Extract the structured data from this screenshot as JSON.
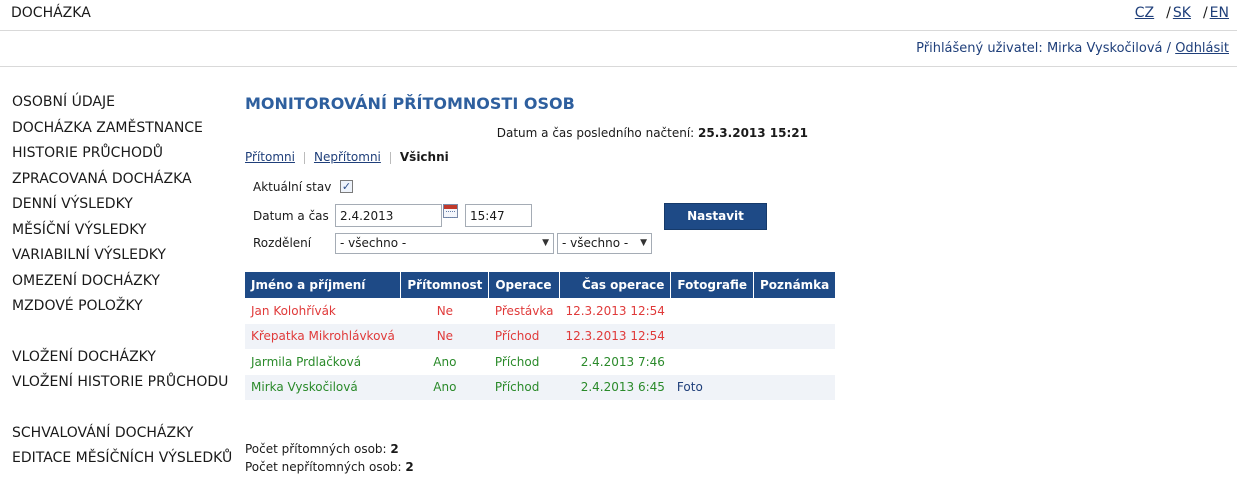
{
  "app": {
    "title": "DOCHÁZKA"
  },
  "languages": [
    "CZ",
    "SK",
    "EN"
  ],
  "user": {
    "prefix": "Přihlášený uživatel:",
    "name": "Mirka Vyskočilová",
    "logout": "Odhlásit"
  },
  "sidebar": {
    "group1": [
      "OSOBNÍ ÚDAJE",
      "DOCHÁZKA ZAMĚSTNANCE",
      "HISTORIE PRŮCHODŮ",
      "ZPRACOVANÁ DOCHÁZKA",
      "DENNÍ VÝSLEDKY",
      "MĚSÍČNÍ VÝSLEDKY",
      "VARIABILNÍ VÝSLEDKY",
      "OMEZENÍ DOCHÁZKY",
      "MZDOVÉ POLOŽKY"
    ],
    "group2": [
      "VLOŽENÍ DOCHÁZKY",
      "VLOŽENÍ HISTORIE PRŮCHODU"
    ],
    "group3": [
      "SCHVALOVÁNÍ DOCHÁZKY",
      "EDITACE MĚSÍČNÍCH VÝSLEDKŮ"
    ]
  },
  "main": {
    "title": "MONITOROVÁNÍ PŘÍTOMNOSTI OSOB",
    "last_load_label": "Datum a čas posledního načtení:",
    "last_load_value": "25.3.2013 15:21",
    "tabs": [
      "Přítomni",
      "Nepřítomni",
      "Všichni"
    ],
    "form": {
      "current_state_label": "Aktuální stav",
      "current_state_checked": true,
      "datetime_label": "Datum a čas",
      "date_value": "2.4.2013",
      "time_value": "15:47",
      "division_label": "Rozdělení",
      "division_value_1": "- všechno -",
      "division_value_2": "- všechno -",
      "submit_label": "Nastavit"
    },
    "table": {
      "headers": [
        "Jméno a příjmení",
        "Přítomnost",
        "Operace",
        "Čas operace",
        "Fotografie",
        "Poznámka"
      ],
      "rows": [
        {
          "name": "Jan Kolohřívák",
          "presence": "Ne",
          "operation": "Přestávka",
          "time": "12.3.2013 12:54",
          "photo": "",
          "note": "",
          "status": "red"
        },
        {
          "name": "Křepatka Mikrohlávková",
          "presence": "Ne",
          "operation": "Příchod",
          "time": "12.3.2013 12:54",
          "photo": "",
          "note": "",
          "status": "red"
        },
        {
          "name": "Jarmila Prdlačková",
          "presence": "Ano",
          "operation": "Příchod",
          "time": "2.4.2013 7:46",
          "photo": "",
          "note": "",
          "status": "green"
        },
        {
          "name": "Mirka Vyskočilová",
          "presence": "Ano",
          "operation": "Příchod",
          "time": "2.4.2013 6:45",
          "photo": "Foto",
          "note": "",
          "status": "green"
        }
      ]
    },
    "summary": {
      "present_label": "Počet přítomných osob:",
      "present_count": "2",
      "absent_label": "Počet nepřítomných osob:",
      "absent_count": "2"
    }
  },
  "colors": {
    "accent": "#1e4a86",
    "title": "#2e5f9e",
    "absent": "#e03a3a",
    "present": "#2a8a2a"
  }
}
